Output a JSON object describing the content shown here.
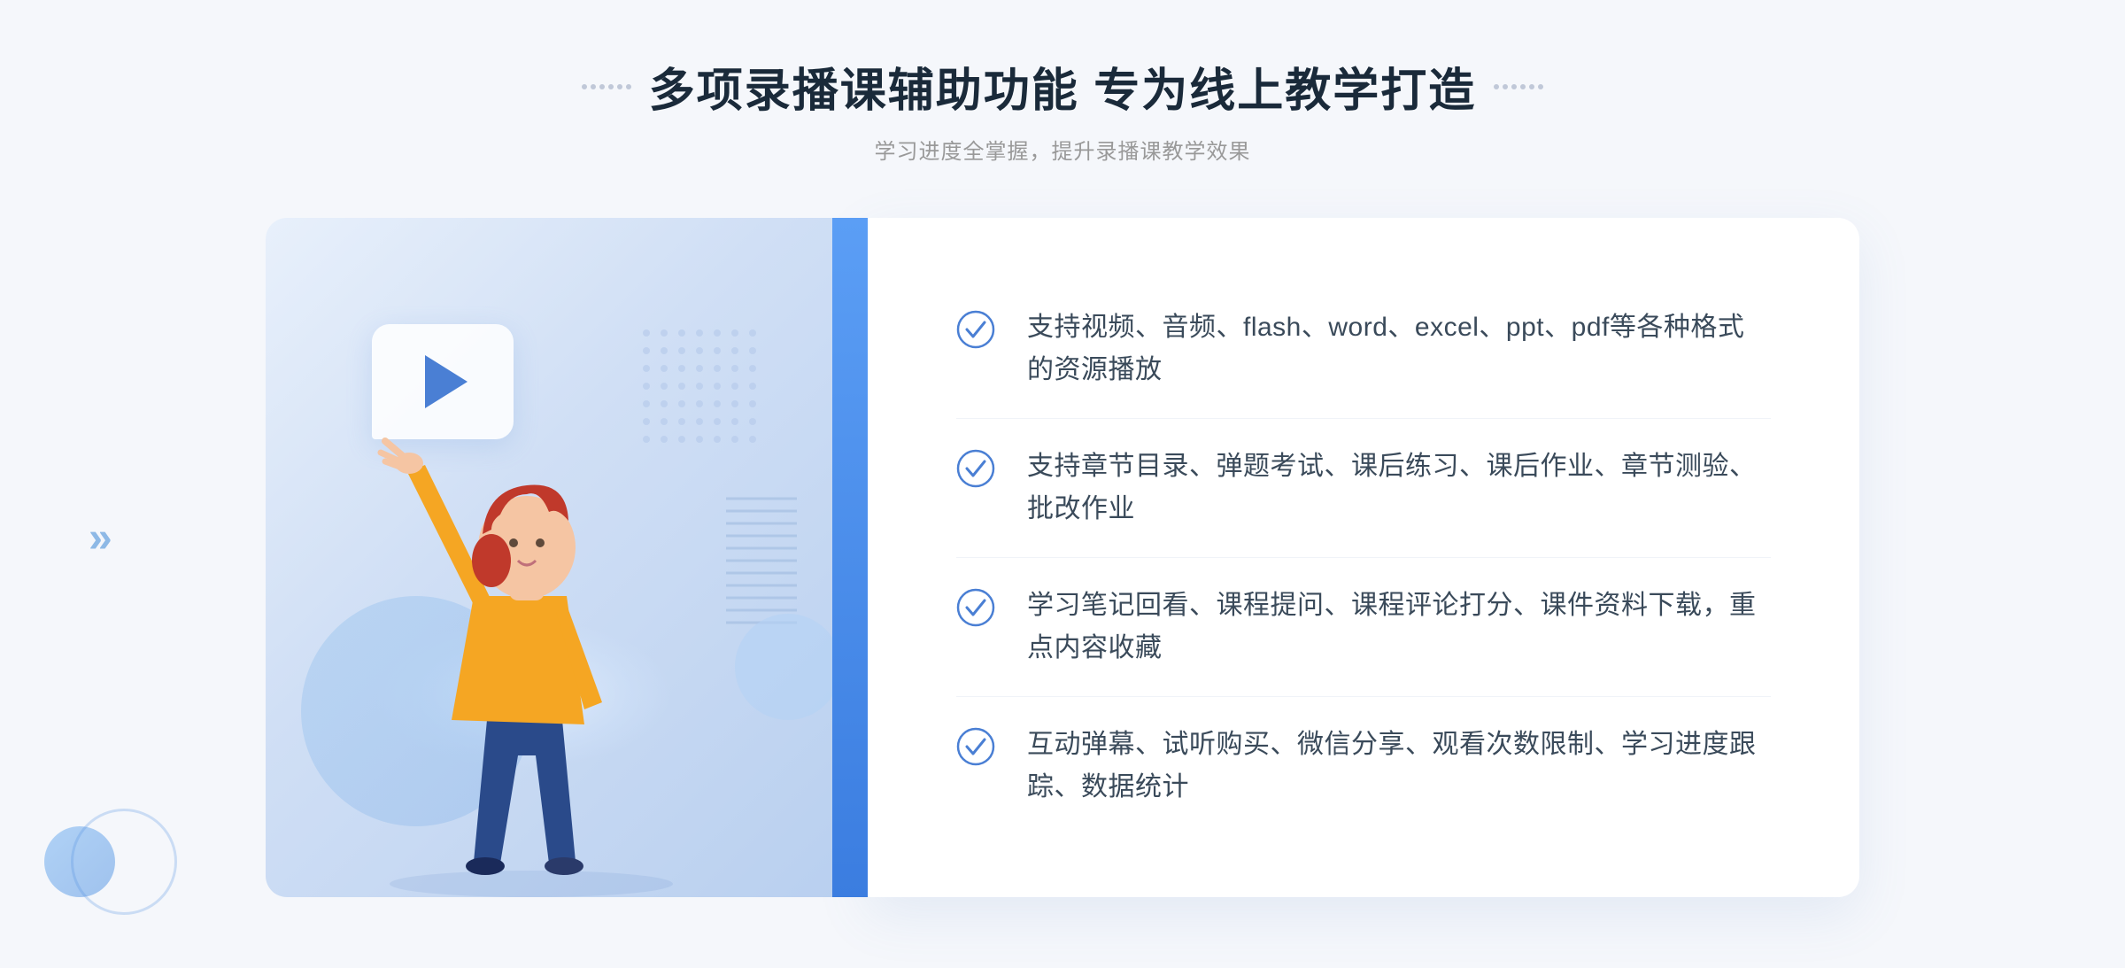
{
  "header": {
    "title": "多项录播课辅助功能 专为线上教学打造",
    "subtitle": "学习进度全掌握，提升录播课教学效果",
    "decorator_count": 8
  },
  "features": [
    {
      "id": 1,
      "text": "支持视频、音频、flash、word、excel、ppt、pdf等各种格式的资源播放"
    },
    {
      "id": 2,
      "text": "支持章节目录、弹题考试、课后练习、课后作业、章节测验、批改作业"
    },
    {
      "id": 3,
      "text": "学习笔记回看、课程提问、课程评论打分、课件资料下载，重点内容收藏"
    },
    {
      "id": 4,
      "text": "互动弹幕、试听购买、微信分享、观看次数限制、学习进度跟踪、数据统计"
    }
  ],
  "colors": {
    "primary_blue": "#3b7de0",
    "light_blue": "#5b9ef5",
    "text_dark": "#1a2a3a",
    "text_medium": "#3a4a5a",
    "text_light": "#999999",
    "check_color": "#4a7fd4",
    "bg_light": "#f5f7fb"
  }
}
